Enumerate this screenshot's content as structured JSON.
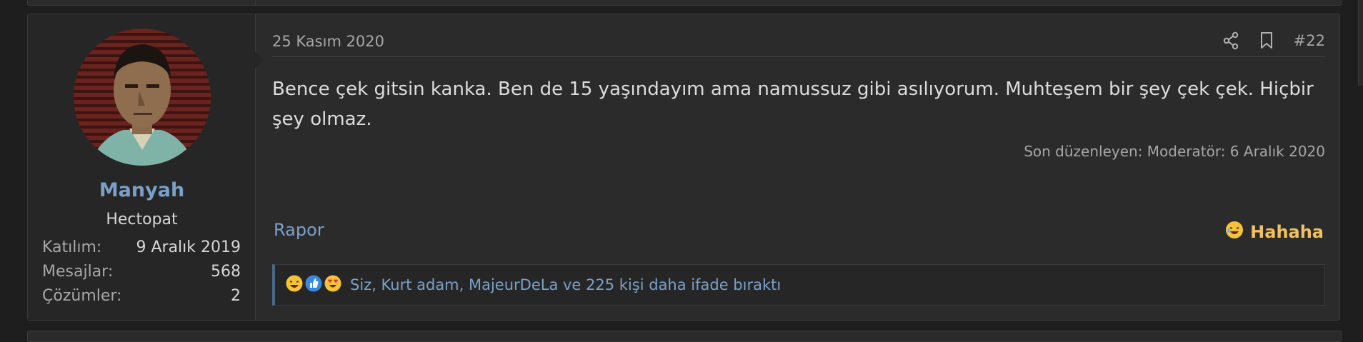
{
  "post": {
    "date": "25 Kasım 2020",
    "number": "#22",
    "body": "Bence çek gitsin kanka. Ben de 15 yaşındayım ama namussuz gibi asılıyorum. Muhteşem bir şey çek çek. Hiçbir şey olmaz.",
    "edited": "Son düzenleyen: Moderatör: 6 Aralık 2020",
    "report_label": "Rapor",
    "reaction_label": "Hahaha",
    "reactions_summary": "Siz, Kurt adam, MajeurDeLa ve 225 kişi daha ifade bıraktı"
  },
  "user": {
    "name": "Manyah",
    "title": "Hectopat",
    "stats": [
      {
        "label": "Katılım:",
        "value": "9 Aralık 2019"
      },
      {
        "label": "Mesajlar:",
        "value": "568"
      },
      {
        "label": "Çözümler:",
        "value": "2"
      }
    ]
  },
  "icons": {
    "share": "share-icon",
    "bookmark": "bookmark-icon",
    "reactions": [
      "laugh-emoji",
      "like-emoji",
      "love-emoji"
    ]
  },
  "colors": {
    "link": "#7aa0c8",
    "reaction": "#f0c15e",
    "background": "#2b2b2b"
  }
}
